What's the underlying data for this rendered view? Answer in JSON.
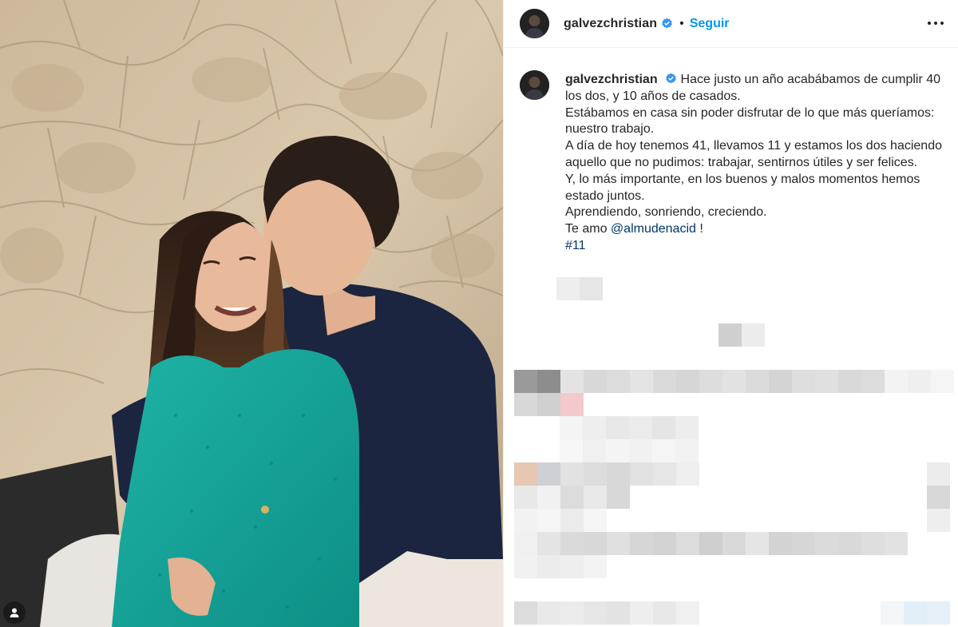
{
  "post": {
    "username": "galvezchristian",
    "follow_label": "Seguir",
    "separator": "•"
  },
  "caption": {
    "username": "galvezchristian",
    "line1": "Hace justo un año acabábamos de cumplir 40 los dos, y 10 años de casados.",
    "line2": "Estábamos en casa sin poder disfrutar de lo que más queríamos: nuestro trabajo.",
    "line3": "A día de hoy tenemos 41, llevamos 11 y estamos los dos haciendo aquello que no pudimos: trabajar, sentirnos útiles y ser felices.",
    "line4": "Y, lo más importante, en los buenos y malos momentos hemos estado juntos.",
    "line5": "Aprendiendo, sonriendo, creciendo.",
    "line6_prefix": "Te amo",
    "mention": "@almudenacid",
    "line6_suffix": "!",
    "hashtag": "#11"
  },
  "icons": {
    "verified": "verified-badge-icon",
    "more": "more-options-icon",
    "tagged_user": "tagged-user-icon"
  },
  "colors": {
    "link": "#0095f6",
    "verified": "#3897f0",
    "mention": "#00376b"
  }
}
